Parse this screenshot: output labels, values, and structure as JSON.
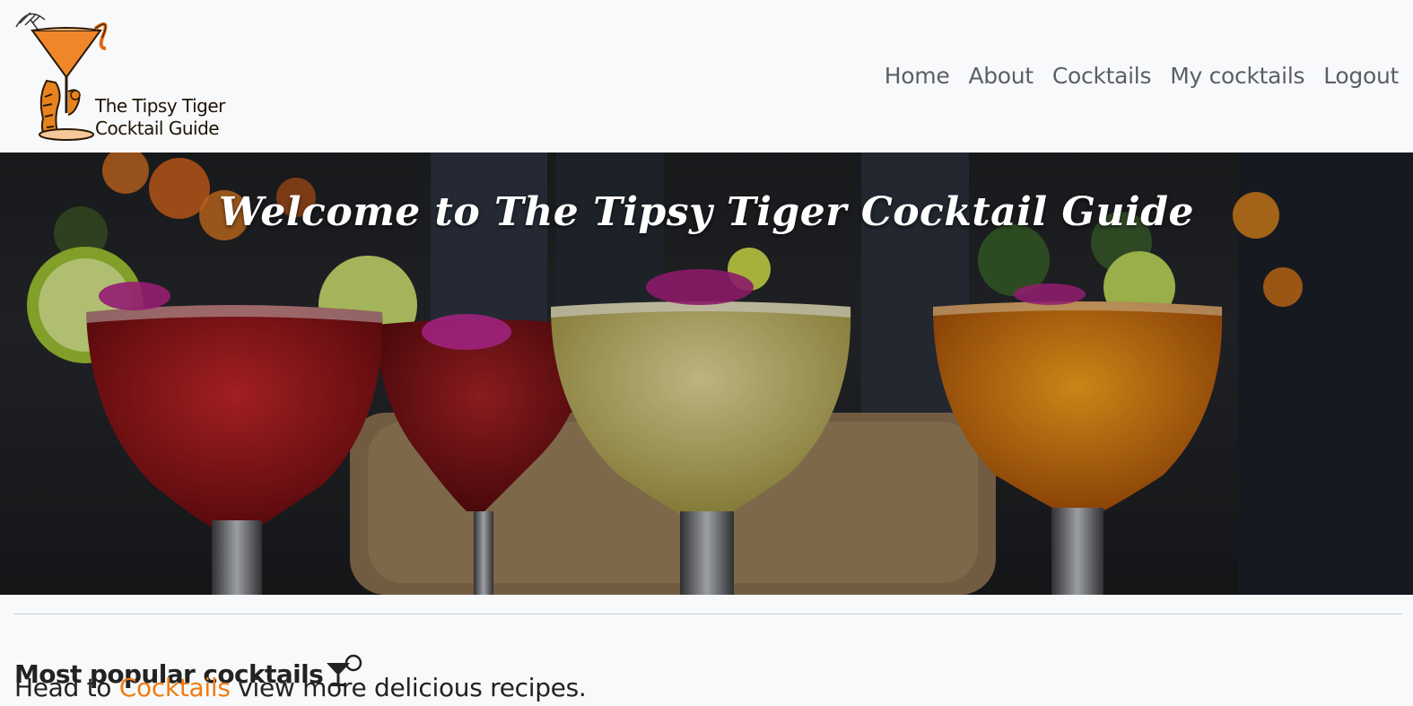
{
  "brand": {
    "line1": "The Tipsy Tiger",
    "line2": "Cocktail Guide",
    "logo_icon": "tiger-martini-logo",
    "accent": "#f07c12"
  },
  "nav": {
    "items": [
      {
        "label": "Home"
      },
      {
        "label": "About"
      },
      {
        "label": "Cocktails"
      },
      {
        "label": "My cocktails"
      },
      {
        "label": "Logout"
      }
    ]
  },
  "hero": {
    "title": "Welcome to The Tipsy Tiger Cocktail Guide",
    "image": "four-margarita-cocktails-photo"
  },
  "popular": {
    "title": "Most popular cocktails",
    "icon": "cocktail-glass-icon",
    "lead_prefix": "Head to ",
    "lead_link": "Cocktails",
    "lead_suffix": " view more delicious recipes."
  }
}
